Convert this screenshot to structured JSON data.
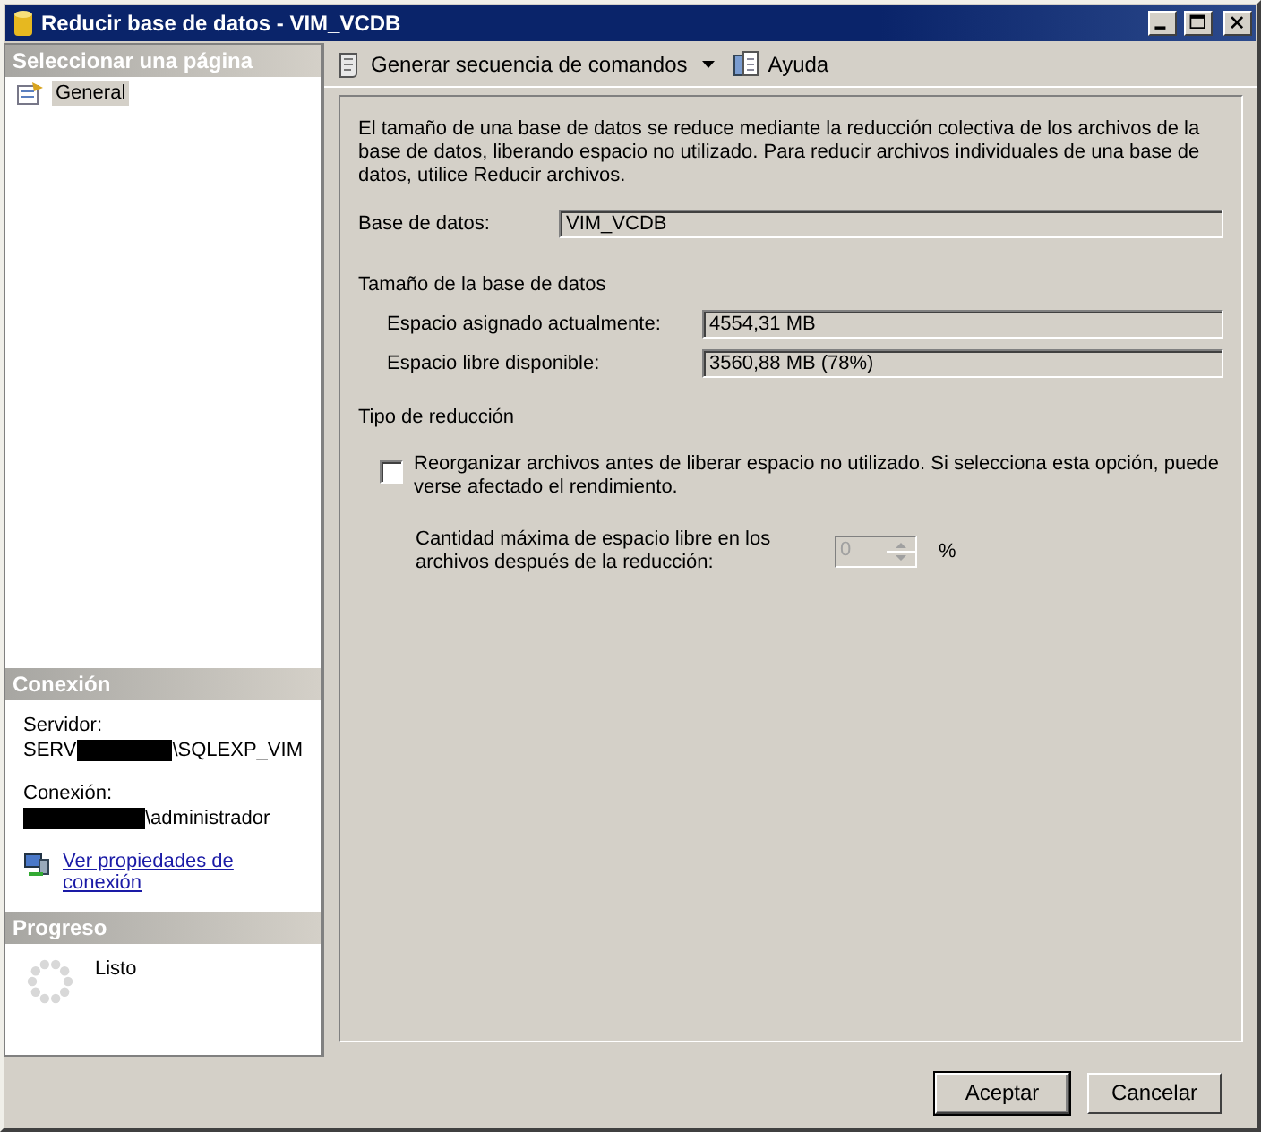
{
  "window": {
    "title": "Reducir base de datos - VIM_VCDB"
  },
  "sidebar": {
    "header": "Seleccionar una página",
    "pages": [
      {
        "label": "General",
        "selected": true
      }
    ]
  },
  "connection": {
    "header": "Conexión",
    "server_label": "Servidor:",
    "server_prefix": "SERV",
    "server_suffix": "\\SQLEXP_VIM",
    "connection_label": "Conexión:",
    "connection_suffix": "\\administrador",
    "link": "Ver propiedades de conexión"
  },
  "progress": {
    "header": "Progreso",
    "status": "Listo"
  },
  "toolbar": {
    "items": [
      {
        "label": "Generar secuencia de comandos",
        "kind": "script",
        "dropdown": true
      },
      {
        "label": "Ayuda",
        "kind": "help",
        "dropdown": false
      }
    ]
  },
  "description": "El tamaño de una base de datos se reduce mediante la reducción colectiva de los archivos de la base de datos, liberando espacio no utilizado. Para reducir archivos individuales de una base de datos, utilice Reducir archivos.",
  "database": {
    "label": "Base de datos:",
    "value": "VIM_VCDB"
  },
  "size": {
    "title": "Tamaño de la base de datos",
    "fields": [
      {
        "label": "Espacio asignado actualmente:",
        "value": "4554,31 MB"
      },
      {
        "label": "Espacio libre disponible:",
        "value": "3560,88 MB (78%)"
      }
    ]
  },
  "shrink": {
    "title": "Tipo de reducción",
    "reorganize": {
      "label": "Reorganizar archivos antes de liberar espacio no utilizado. Si selecciona esta opción, puede verse afectado el rendimiento.",
      "checked": false
    },
    "max_free": {
      "label": "Cantidad máxima de espacio libre en los archivos después de la reducción:",
      "value": "0",
      "unit": "%",
      "disabled": true
    }
  },
  "buttons": [
    {
      "label": "Aceptar",
      "default": true
    },
    {
      "label": "Cancelar",
      "default": false
    }
  ]
}
